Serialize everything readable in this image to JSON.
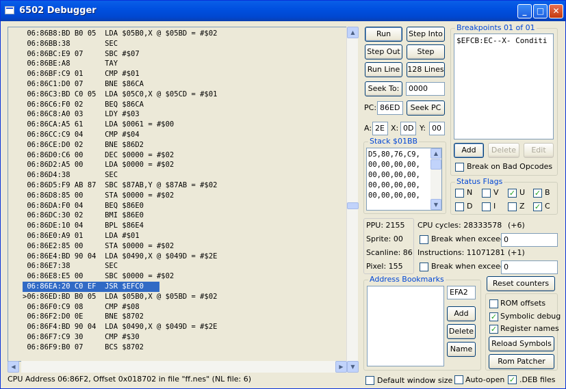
{
  "window": {
    "title": "6502 Debugger",
    "minimize": "_",
    "maximize": "□",
    "close": "✕"
  },
  "code_lines": [
    " 06:86B8:BD B0 05  LDA $05B0,X @ $05BD = #$02",
    " 06:86BB:38        SEC",
    " 06:86BC:E9 07     SBC #$07",
    " 06:86BE:A8        TAY",
    " 06:86BF:C9 01     CMP #$01",
    " 06:86C1:D0 07     BNE $86CA",
    " 06:86C3:BD C0 05  LDA $05C0,X @ $05CD = #$01",
    " 06:86C6:F0 02     BEQ $86CA",
    " 06:86C8:A0 03     LDY #$03",
    " 06:86CA:A5 61     LDA $0061 = #$00",
    " 06:86CC:C9 04     CMP #$04",
    " 06:86CE:D0 02     BNE $86D2",
    " 06:86D0:C6 00     DEC $0000 = #$02",
    " 06:86D2:A5 00     LDA $0000 = #$02",
    " 06:86D4:38        SEC",
    " 06:86D5:F9 AB 87  SBC $87AB,Y @ $87AB = #$02",
    " 06:86D8:85 00     STA $0000 = #$02",
    " 06:86DA:F0 04     BEQ $86E0",
    " 06:86DC:30 02     BMI $86E0",
    " 06:86DE:10 04     BPL $86E4",
    " 06:86E0:A9 01     LDA #$01",
    " 06:86E2:85 00     STA $0000 = #$02",
    " 06:86E4:BD 90 04  LDA $0490,X @ $049D = #$2E",
    " 06:86E7:38        SEC",
    " 06:86E8:E5 00     SBC $0000 = #$02",
    " 06:86EA:20 C0 EF  JSR $EFC0",
    ">06:86ED:BD B0 05  LDA $05B0,X @ $05BD = #$02",
    " 06:86F0:C9 08     CMP #$08",
    " 06:86F2:D0 0E     BNE $8702",
    " 06:86F4:BD 90 04  LDA $0490,X @ $049D = #$2E",
    " 06:86F7:C9 30     CMP #$30",
    " 06:86F9:B0 07     BCS $8702"
  ],
  "selected_line_index": 25,
  "status_bar": "CPU Address 06:86F2, Offset 0x018702 in file \"ff.nes\" (NL file: 6)",
  "controls": {
    "run": "Run",
    "step_into": "Step Into",
    "step_out": "Step Out",
    "step_over": "Step Over",
    "run_line": "Run Line",
    "run_128": "128 Lines",
    "seek_to": "Seek To:",
    "seek_value": "0000",
    "pc_label": "PC:",
    "pc_value": "86ED",
    "seek_pc": "Seek PC",
    "a_label": "A:",
    "a_value": "2E",
    "x_label": "X:",
    "x_value": "0D",
    "y_label": "Y:",
    "y_value": "00"
  },
  "stack": {
    "title": "Stack $01BB",
    "text": "D5,80,76,C9,\n00,00,00,00,\n00,00,00,00,\n00,00,00,00,\n00,00,00,00,"
  },
  "breakpoints": {
    "title": "Breakpoints 01 of 01",
    "entry": "$EFCB:EC--X- Conditi",
    "add": "Add",
    "delete": "Delete",
    "edit": "Edit",
    "break_bad": "Break on Bad Opcodes"
  },
  "status_flags": {
    "title": "Status Flags",
    "flags": [
      {
        "label": "N",
        "checked": false
      },
      {
        "label": "V",
        "checked": false
      },
      {
        "label": "U",
        "checked": true
      },
      {
        "label": "B",
        "checked": true
      },
      {
        "label": "D",
        "checked": false
      },
      {
        "label": "I",
        "checked": false
      },
      {
        "label": "Z",
        "checked": false
      },
      {
        "label": "C",
        "checked": true
      }
    ]
  },
  "ppu": {
    "ppu": "PPU:  2155",
    "sprite": "Sprite:  00",
    "scanline": "Scanline:  86",
    "pixel": "Pixel:  155"
  },
  "cycles": {
    "cpu_cycles": "CPU cycles: 28333578",
    "cpu_delta": "(+6)",
    "break_exceed_1": "Break when exceed",
    "exceed_value_1": "0",
    "instructions": "Instructions: 11071281",
    "instr_delta": "(+1)",
    "break_exceed_2": "Break when exceed",
    "exceed_value_2": "0"
  },
  "bookmarks": {
    "title": "Address Bookmarks",
    "address": "EFA2",
    "add": "Add",
    "delete": "Delete",
    "name": "Name"
  },
  "reset_counters": "Reset counters",
  "options": {
    "rom_offsets": "ROM offsets",
    "symbolic_debug": "Symbolic debug",
    "register_names": "Register names"
  },
  "reload_symbols": "Reload Symbols",
  "rom_patcher": "Rom Patcher",
  "bottom": {
    "default_window_size": "Default window size",
    "auto_open": "Auto-open",
    "deb_files": ".DEB files"
  },
  "checks": {
    "rom_offsets": false,
    "symbolic_debug": true,
    "register_names": true,
    "break_bad": false,
    "break_exceed_1": false,
    "break_exceed_2": false,
    "default_window_size": false,
    "auto_open": false,
    "deb_files": true
  }
}
